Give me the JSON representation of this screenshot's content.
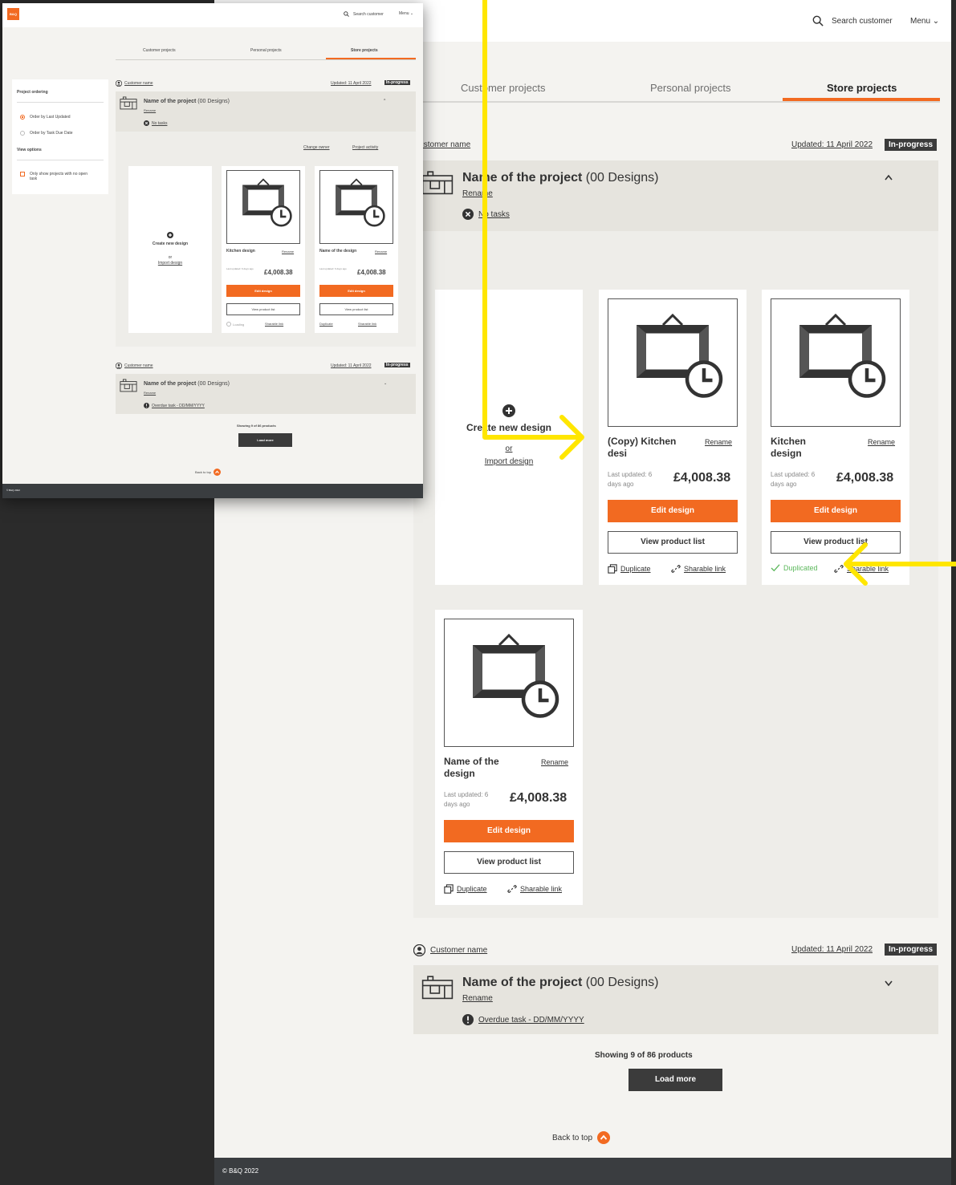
{
  "header": {
    "search_placeholder": "Search customer",
    "menu_label": "Menu",
    "logo_text": "B&Q"
  },
  "tabs": [
    {
      "label": "Customer projects",
      "active": false
    },
    {
      "label": "Personal projects",
      "active": false
    },
    {
      "label": "Store projects",
      "active": true
    }
  ],
  "sidebar": {
    "ordering_title": "Project ordering",
    "ordering_options": [
      {
        "label": "Order by Last Updated",
        "selected": true
      },
      {
        "label": "Order by Task Due Date",
        "selected": false
      }
    ],
    "view_title": "View options",
    "view_option": "Only show projects with no open task"
  },
  "projects": [
    {
      "customer": "Customer name",
      "updated": "Updated: 11 April 2022",
      "status": "In-progress",
      "title_bold": "Name of the project",
      "title_rest": " (00 Designs)",
      "rename": "Rename",
      "task": "No tasks",
      "expanded": true
    },
    {
      "customer": "Customer name",
      "updated": "Updated: 11 April 2022",
      "status": "In-progress",
      "title_bold": "Name of the project",
      "title_rest": " (00 Designs)",
      "rename": "Rename",
      "task": "Overdue task - DD/MM/YYYY",
      "expanded": false
    }
  ],
  "actions": {
    "change_owner": "Change owner",
    "project_activity": "Project activity"
  },
  "create_card": {
    "create_label": "Create new design",
    "or_label": "or",
    "import_label": "Import design"
  },
  "designs": [
    {
      "name": "(Copy) Kitchen desi",
      "rename": "Rename",
      "updated": "Last updated: 6 days ago",
      "price": "£4,008.38",
      "edit": "Edit design",
      "view": "View product list",
      "duplicate": "Duplicate",
      "share": "Sharable link"
    },
    {
      "name": "Kitchen design",
      "rename": "Rename",
      "updated": "Last updated: 6 days ago",
      "price": "£4,008.38",
      "edit": "Edit design",
      "view": "View product list",
      "duplicated": "Duplicated",
      "share": "Sharable link"
    },
    {
      "name": "Name of the design",
      "rename": "Rename",
      "updated": "Last updated: 6 days ago",
      "price": "£4,008.38",
      "edit": "Edit design",
      "view": "View product list",
      "duplicate": "Duplicate",
      "share": "Sharable link"
    }
  ],
  "small_designs": [
    {
      "name": "Kitchen design",
      "rename": "Rename",
      "loading": "Loading"
    },
    {
      "name": "Name of the design",
      "rename": "Rename",
      "duplicate": "Duplicate"
    }
  ],
  "pagination": {
    "showing": "Showing 9 of 86 products",
    "load_more": "Load more"
  },
  "back_to_top": "Back to top",
  "footer": "© B&Q 2022",
  "colors": {
    "accent": "#f26a21",
    "dark": "#3b3b3b",
    "annotation": "#ffe600",
    "success": "#5cb85c"
  }
}
